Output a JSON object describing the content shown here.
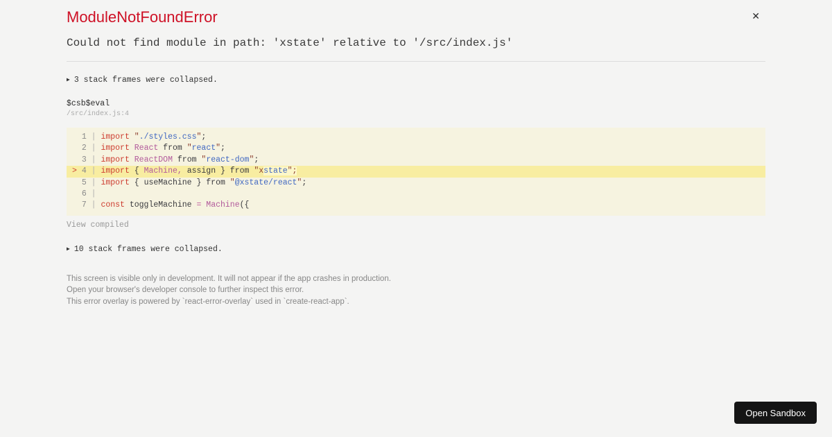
{
  "overlay": {
    "title": "ModuleNotFoundError",
    "message": "Could not find module in path: 'xstate' relative to '/src/index.js'",
    "close_icon_glyph": "✕",
    "collapsed_top": "3 stack frames were collapsed.",
    "collapsed_bottom": "10 stack frames were collapsed.",
    "expand_triangle_glyph": "▶",
    "frame": {
      "function_name": "$csb$eval",
      "location": "/src/index.js:4",
      "view_toggle_label": "View compiled"
    },
    "footer_lines": [
      "This screen is visible only in development. It will not appear if the app crashes in production.",
      "Open your browser's developer console to further inspect this error.",
      "This error overlay is powered by `react-error-overlay` used in `create-react-app`."
    ],
    "colors": {
      "error_red": "#ce1126",
      "page_background": "#f4f4f3",
      "code_background": "#f6f3e0",
      "highlight_line": "#f8eda1",
      "highlight_token": "#fdf7c9",
      "keyword": "#cd3d30",
      "capitalized_identifier": "#b25a9b",
      "string": "#4168c2",
      "string_quote": "#8d4130",
      "button_background": "#151515"
    }
  },
  "code_frame": {
    "lines": [
      {
        "num": "1",
        "marker": "",
        "highlight": false,
        "tokens": [
          [
            "kw",
            "import"
          ],
          [
            "pl",
            " "
          ],
          [
            "qt",
            "\""
          ],
          [
            "str",
            "./styles.css"
          ],
          [
            "qt",
            "\""
          ],
          [
            "pl",
            ";"
          ]
        ]
      },
      {
        "num": "2",
        "marker": "",
        "highlight": false,
        "tokens": [
          [
            "kw",
            "import"
          ],
          [
            "pl",
            " "
          ],
          [
            "cap",
            "React"
          ],
          [
            "pl",
            " from "
          ],
          [
            "qt",
            "\""
          ],
          [
            "str",
            "react"
          ],
          [
            "qt",
            "\""
          ],
          [
            "pl",
            ";"
          ]
        ]
      },
      {
        "num": "3",
        "marker": "",
        "highlight": false,
        "tokens": [
          [
            "kw",
            "import"
          ],
          [
            "pl",
            " "
          ],
          [
            "cap",
            "ReactDOM"
          ],
          [
            "pl",
            " from "
          ],
          [
            "qt",
            "\""
          ],
          [
            "str",
            "react-dom"
          ],
          [
            "qt",
            "\""
          ],
          [
            "pl",
            ";"
          ]
        ]
      },
      {
        "num": "4",
        "marker": ">",
        "highlight": true,
        "tokens": [
          [
            "kw",
            "import"
          ],
          [
            "pl",
            " { "
          ],
          [
            "cap",
            "Machine,"
          ],
          [
            "pl",
            " assign } from "
          ],
          [
            "qt",
            "\"x"
          ],
          [
            "str m",
            "state"
          ],
          [
            "qt m",
            "\";"
          ]
        ]
      },
      {
        "num": "5",
        "marker": "",
        "highlight": false,
        "tokens": [
          [
            "kw",
            "import"
          ],
          [
            "pl",
            " { useMachine } from "
          ],
          [
            "qt",
            "\""
          ],
          [
            "str",
            "@xstate/react"
          ],
          [
            "qt",
            "\""
          ],
          [
            "pl",
            ";"
          ]
        ]
      },
      {
        "num": "6",
        "marker": "",
        "highlight": false,
        "tokens": []
      },
      {
        "num": "7",
        "marker": "",
        "highlight": false,
        "tokens": [
          [
            "kw",
            "const"
          ],
          [
            "pl",
            " toggleMachine "
          ],
          [
            "op",
            "="
          ],
          [
            "pl",
            " "
          ],
          [
            "cap",
            "Machine"
          ],
          [
            "pl",
            "({"
          ]
        ]
      }
    ]
  },
  "open_sandbox": {
    "label": "Open Sandbox"
  }
}
